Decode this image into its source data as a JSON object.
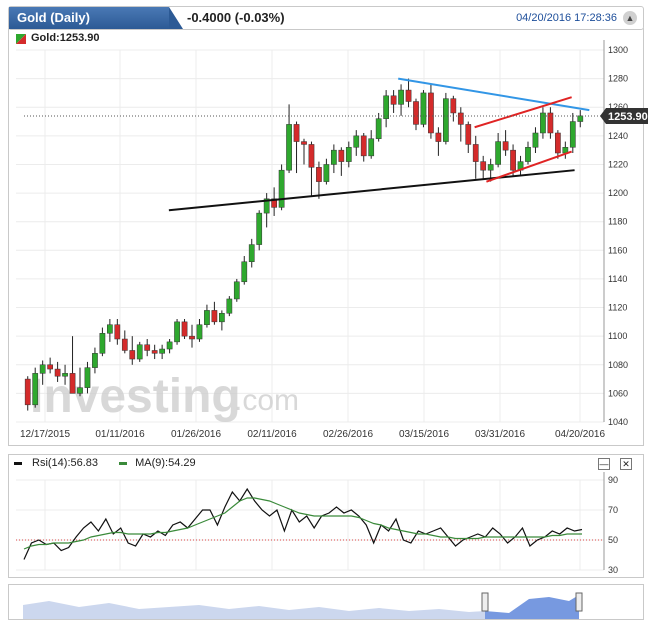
{
  "header": {
    "title": "Gold (Daily)",
    "change": "-0.4000 (-0.03%)",
    "datetime": "04/20/2016 17:28:36"
  },
  "symbol": {
    "label": "Gold:1253.90",
    "price_tag": "1253.90"
  },
  "watermark": {
    "brand": "Investing",
    "suffix": ".com"
  },
  "rsi_legend": {
    "rsi_label": "Rsi(14):56.83",
    "ma_label": "MA(9):54.29"
  },
  "colors": {
    "up": "#2ea82e",
    "down": "#d42b2b",
    "blue_trend": "#3296e6",
    "red_channel": "#e02424",
    "support": "#111111",
    "ma_line": "#3a8a3a",
    "nav_fill": "#7799e0"
  },
  "chart_data": [
    {
      "type": "candlestick",
      "ylim": [
        1040,
        1300
      ],
      "y_ticks": [
        1040,
        1060,
        1080,
        1100,
        1120,
        1140,
        1160,
        1180,
        1200,
        1220,
        1240,
        1260,
        1280,
        1300
      ],
      "x_labels": [
        "12/17/2015",
        "01/11/2016",
        "01/26/2016",
        "02/11/2016",
        "02/26/2016",
        "03/15/2016",
        "03/31/2016",
        "04/20/2016"
      ],
      "candles": [
        [
          1070,
          1072,
          1048,
          1052
        ],
        [
          1052,
          1078,
          1050,
          1074
        ],
        [
          1074,
          1083,
          1066,
          1080
        ],
        [
          1080,
          1085,
          1074,
          1077
        ],
        [
          1077,
          1082,
          1068,
          1072
        ],
        [
          1072,
          1080,
          1066,
          1074
        ],
        [
          1074,
          1100,
          1062,
          1060
        ],
        [
          1060,
          1078,
          1058,
          1064
        ],
        [
          1064,
          1082,
          1060,
          1078
        ],
        [
          1078,
          1092,
          1074,
          1088
        ],
        [
          1088,
          1106,
          1086,
          1102
        ],
        [
          1102,
          1112,
          1096,
          1108
        ],
        [
          1108,
          1112,
          1094,
          1098
        ],
        [
          1098,
          1104,
          1088,
          1090
        ],
        [
          1090,
          1100,
          1080,
          1084
        ],
        [
          1084,
          1096,
          1082,
          1094
        ],
        [
          1094,
          1098,
          1086,
          1090
        ],
        [
          1090,
          1094,
          1084,
          1088
        ],
        [
          1088,
          1094,
          1084,
          1091
        ],
        [
          1091,
          1098,
          1088,
          1096
        ],
        [
          1096,
          1112,
          1094,
          1110
        ],
        [
          1110,
          1112,
          1098,
          1100
        ],
        [
          1100,
          1108,
          1092,
          1098
        ],
        [
          1098,
          1112,
          1096,
          1108
        ],
        [
          1108,
          1122,
          1106,
          1118
        ],
        [
          1118,
          1124,
          1108,
          1110
        ],
        [
          1110,
          1118,
          1104,
          1116
        ],
        [
          1116,
          1128,
          1114,
          1126
        ],
        [
          1126,
          1140,
          1124,
          1138
        ],
        [
          1138,
          1156,
          1136,
          1152
        ],
        [
          1152,
          1168,
          1148,
          1164
        ],
        [
          1164,
          1188,
          1160,
          1186
        ],
        [
          1186,
          1200,
          1176,
          1196
        ],
        [
          1196,
          1204,
          1184,
          1190
        ],
        [
          1190,
          1220,
          1188,
          1216
        ],
        [
          1216,
          1262,
          1214,
          1248
        ],
        [
          1248,
          1250,
          1214,
          1236
        ],
        [
          1236,
          1238,
          1220,
          1234
        ],
        [
          1234,
          1236,
          1198,
          1218
        ],
        [
          1218,
          1222,
          1196,
          1208
        ],
        [
          1208,
          1224,
          1206,
          1220
        ],
        [
          1220,
          1234,
          1214,
          1230
        ],
        [
          1230,
          1232,
          1212,
          1222
        ],
        [
          1222,
          1236,
          1218,
          1232
        ],
        [
          1232,
          1244,
          1226,
          1240
        ],
        [
          1240,
          1242,
          1222,
          1226
        ],
        [
          1226,
          1244,
          1224,
          1238
        ],
        [
          1238,
          1256,
          1236,
          1252
        ],
        [
          1252,
          1272,
          1246,
          1268
        ],
        [
          1268,
          1272,
          1256,
          1262
        ],
        [
          1262,
          1276,
          1254,
          1272
        ],
        [
          1272,
          1280,
          1260,
          1264
        ],
        [
          1264,
          1266,
          1244,
          1248
        ],
        [
          1248,
          1272,
          1246,
          1270
        ],
        [
          1270,
          1276,
          1238,
          1242
        ],
        [
          1242,
          1246,
          1226,
          1236
        ],
        [
          1236,
          1270,
          1234,
          1266
        ],
        [
          1266,
          1268,
          1250,
          1256
        ],
        [
          1256,
          1260,
          1236,
          1248
        ],
        [
          1248,
          1250,
          1228,
          1234
        ],
        [
          1234,
          1240,
          1210,
          1222
        ],
        [
          1222,
          1226,
          1210,
          1216
        ],
        [
          1216,
          1224,
          1208,
          1220
        ],
        [
          1220,
          1242,
          1218,
          1236
        ],
        [
          1236,
          1244,
          1226,
          1230
        ],
        [
          1230,
          1234,
          1212,
          1216
        ],
        [
          1216,
          1226,
          1212,
          1222
        ],
        [
          1222,
          1236,
          1220,
          1232
        ],
        [
          1232,
          1246,
          1228,
          1242
        ],
        [
          1242,
          1260,
          1238,
          1256
        ],
        [
          1256,
          1260,
          1238,
          1242
        ],
        [
          1242,
          1244,
          1224,
          1228
        ],
        [
          1228,
          1236,
          1224,
          1232
        ],
        [
          1232,
          1256,
          1228,
          1250
        ],
        [
          1250,
          1258,
          1246,
          1254
        ]
      ],
      "trendlines": [
        {
          "color": "support",
          "x": [
            0.26,
            0.95
          ],
          "y": [
            1188,
            1216
          ]
        },
        {
          "color": "blue_trend",
          "x": [
            0.65,
            0.975
          ],
          "y": [
            1280,
            1258
          ]
        },
        {
          "color": "red_channel",
          "x": [
            0.78,
            0.945
          ],
          "y": [
            1246,
            1267
          ]
        },
        {
          "color": "red_channel",
          "x": [
            0.8,
            0.945
          ],
          "y": [
            1208,
            1229
          ]
        }
      ],
      "current_price": 1253.9
    },
    {
      "type": "line",
      "ylim": [
        30,
        90
      ],
      "y_ticks": [
        30,
        50,
        70,
        90
      ],
      "ref_line": 50,
      "series": [
        {
          "name": "Rsi(14)",
          "values": [
            37,
            48,
            50,
            47,
            48,
            43,
            45,
            52,
            58,
            62,
            56,
            64,
            54,
            58,
            48,
            46,
            54,
            52,
            56,
            53,
            60,
            62,
            58,
            64,
            70,
            70,
            60,
            72,
            82,
            76,
            84,
            76,
            70,
            66,
            70,
            56,
            70,
            62,
            66,
            58,
            66,
            68,
            72,
            68,
            70,
            66,
            60,
            48,
            60,
            56,
            64,
            50,
            48,
            56,
            54,
            56,
            58,
            52,
            46,
            50,
            52,
            54,
            52,
            58,
            54,
            48,
            52,
            58,
            46,
            50,
            52,
            56,
            54,
            58,
            56,
            57
          ]
        },
        {
          "name": "MA(9)",
          "values": [
            44,
            46,
            47,
            47,
            48,
            48,
            48,
            49,
            50,
            52,
            53,
            54,
            55,
            55,
            54,
            54,
            54,
            54,
            55,
            55,
            56,
            57,
            58,
            60,
            62,
            64,
            66,
            68,
            72,
            76,
            78,
            78,
            77,
            76,
            74,
            72,
            70,
            68,
            67,
            66,
            66,
            66,
            66,
            66,
            66,
            65,
            63,
            61,
            60,
            58,
            57,
            56,
            55,
            54,
            54,
            53,
            52,
            52,
            51,
            51,
            51,
            51,
            52,
            52,
            52,
            52,
            52,
            52,
            52,
            52,
            52,
            53,
            53,
            54,
            54,
            54
          ]
        }
      ]
    }
  ]
}
